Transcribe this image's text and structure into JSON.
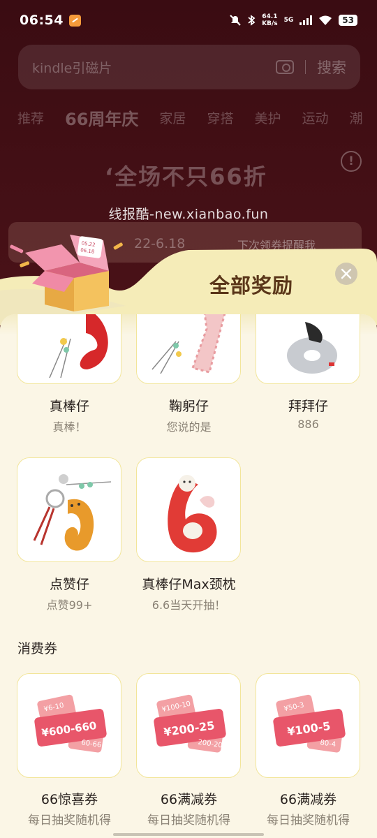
{
  "status_bar": {
    "time": "06:54",
    "net_speed_value": "64.1",
    "net_speed_unit": "KB/s",
    "network": "5G",
    "battery": "53"
  },
  "search": {
    "placeholder": "kindle引磁片",
    "button_label": "搜索"
  },
  "category_tabs": [
    "推荐",
    "66周年庆",
    "家居",
    "穿搭",
    "美护",
    "运动",
    "潮"
  ],
  "promo": {
    "title": "‘全场不只66折",
    "dates": "22-6.18",
    "remind_label": "下次领券提醒我"
  },
  "watermark": "线报酷-new.xianbao.fun",
  "modal": {
    "title": "全部奖励",
    "gift_box_dates": [
      "05.22",
      "06.18"
    ],
    "section_coupons": "消费券",
    "items": [
      {
        "name": "真棒仔",
        "sub": "真棒！",
        "icon": "red-plush-keychain-icon"
      },
      {
        "name": "鞠躬仔",
        "sub": "您说的是",
        "icon": "checkered-plush-keychain-icon"
      },
      {
        "name": "拜拜仔",
        "sub": "886",
        "icon": "silver-plush-keychain-icon"
      },
      {
        "name": "点赞仔",
        "sub": "点赞99+",
        "icon": "orange-plush-keychain-icon"
      },
      {
        "name": "真棒仔Max颈枕",
        "sub": "6.6当天开抽！",
        "icon": "red-neck-pillow-icon"
      }
    ],
    "coupons": [
      {
        "name": "66惊喜券",
        "sub": "每日抽奖随机得",
        "main": "¥600-660",
        "top": "¥6-10",
        "bottom": "60-66"
      },
      {
        "name": "66满减券",
        "sub": "每日抽奖随机得",
        "main": "¥200-25",
        "top": "¥100-10",
        "bottom": "200-20"
      },
      {
        "name": "66满减券",
        "sub": "每日抽奖随机得",
        "main": "¥100-5",
        "top": "¥50-3",
        "bottom": "80-4"
      }
    ]
  },
  "colors": {
    "sheet_bg": "#fbf6e6",
    "header_yellow": "#fdf3b8",
    "card_border": "#f2e59a",
    "title_brown": "#5a3619",
    "coupon_pink": "#e8566a",
    "coupon_light": "#f3a0a4"
  }
}
